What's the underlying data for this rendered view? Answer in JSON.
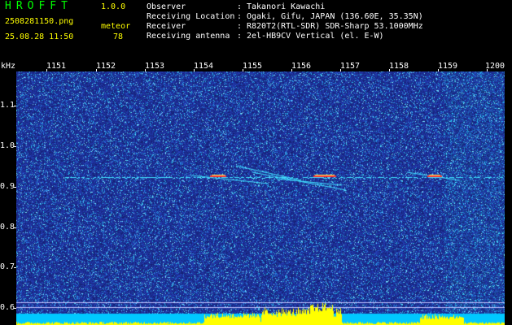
{
  "header": {
    "app_title": "HROFFT",
    "app_version": "1.0.0",
    "file_name": "2508281150.png",
    "date_time": "25.08.28 11:50",
    "mode_label": "meteor",
    "count_value": "78",
    "info": [
      {
        "label": "Observer",
        "value": "Takanori Kawachi"
      },
      {
        "label": "Receiving Location",
        "value": "Ogaki, Gifu, JAPAN (136.60E, 35.35N)"
      },
      {
        "label": "Receiver",
        "value": "R820T2(RTL-SDR) SDR-Sharp 53.1000MHz"
      },
      {
        "label": "Receiving antenna",
        "value": "2el-HB9CV Vertical (el. E-W)"
      }
    ]
  },
  "axes": {
    "y_unit": "kHz",
    "x_ticks": [
      "1151",
      "1152",
      "1153",
      "1154",
      "1155",
      "1156",
      "1157",
      "1158",
      "1159",
      "1200"
    ],
    "y_ticks": [
      "1.1",
      "1.0",
      "0.9",
      "0.8",
      "0.7",
      "0.6"
    ],
    "y_range": [
      0.56,
      1.18
    ]
  },
  "colors": {
    "background": "#000000",
    "waterfall_base": "#1a2a8c",
    "signal_line": "#40e0ff",
    "meteor_hot": "#ff3030",
    "level_bars": "#ffff00",
    "level_base": "#00c8ff",
    "text_yellow": "#ffff00",
    "text_white": "#ffffff",
    "text_green": "#00ff00"
  }
}
